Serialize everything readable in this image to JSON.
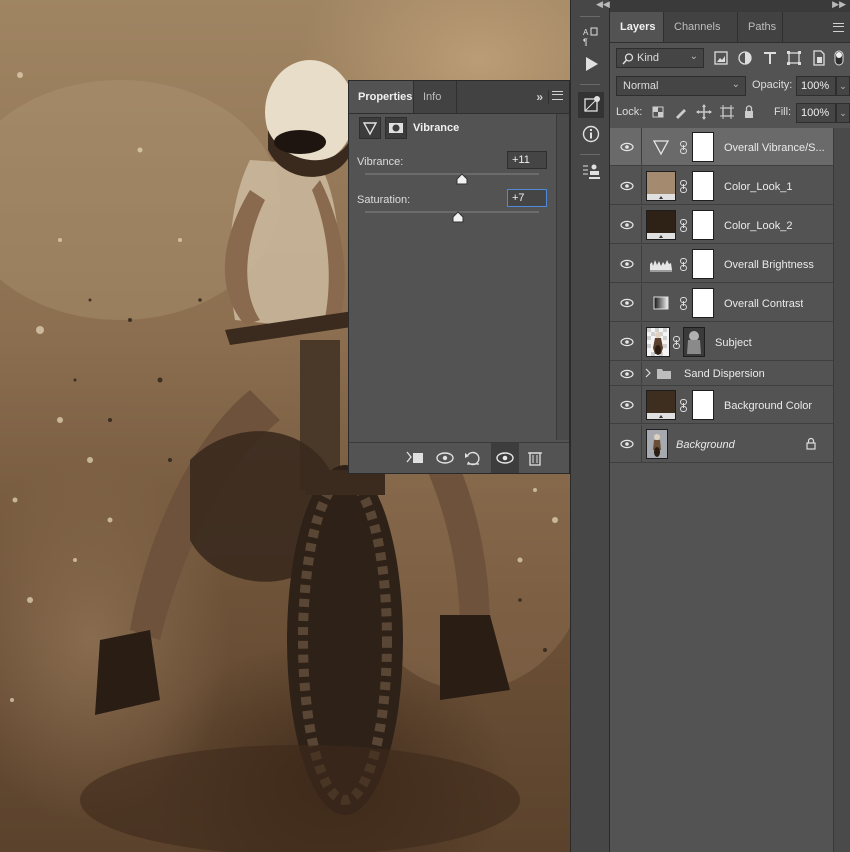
{
  "properties_panel": {
    "tabs": [
      "Properties",
      "Info"
    ],
    "adjustment_title": "Vibrance",
    "vibrance": {
      "label": "Vibrance:",
      "value": "+11",
      "level": 0.555
    },
    "saturation": {
      "label": "Saturation:",
      "value": "+7",
      "level": 0.535
    },
    "icons": [
      "collapse-icon",
      "menu-icon",
      "vibrance-icon",
      "mask-icon",
      "clip-to-layer-icon",
      "view-previous-icon",
      "reset-icon",
      "visibility-icon",
      "trash-icon"
    ]
  },
  "tool_strip": {
    "icons": [
      "character-paragraph-icon",
      "play-icon",
      "adjustments-icon",
      "info-icon",
      "puppet-icon"
    ]
  },
  "layers_panel": {
    "tabs": [
      "Layers",
      "Channels",
      "Paths"
    ],
    "filter": {
      "kind_label": "Kind"
    },
    "blend_mode": "Normal",
    "opacity_label": "Opacity:",
    "opacity_value": "100%",
    "lock_label": "Lock:",
    "fill_label": "Fill:",
    "fill_value": "100%",
    "layers": [
      {
        "name": "Overall Vibrance/S...",
        "type": "adjustment-vibrance",
        "selected": true
      },
      {
        "name": "Color_Look_1",
        "type": "solid-color",
        "color": "#a48a6e"
      },
      {
        "name": "Color_Look_2",
        "type": "solid-color",
        "color": "#2e2116"
      },
      {
        "name": "Overall Brightness",
        "type": "adjustment-levels"
      },
      {
        "name": "Overall Contrast",
        "type": "adjustment-gradient"
      },
      {
        "name": "Subject",
        "type": "pixel"
      },
      {
        "name": "Sand Dispersion",
        "type": "group"
      },
      {
        "name": "Background Color",
        "type": "solid-color",
        "color": "#3d2e20"
      },
      {
        "name": "Background",
        "type": "background",
        "locked": true
      }
    ]
  }
}
